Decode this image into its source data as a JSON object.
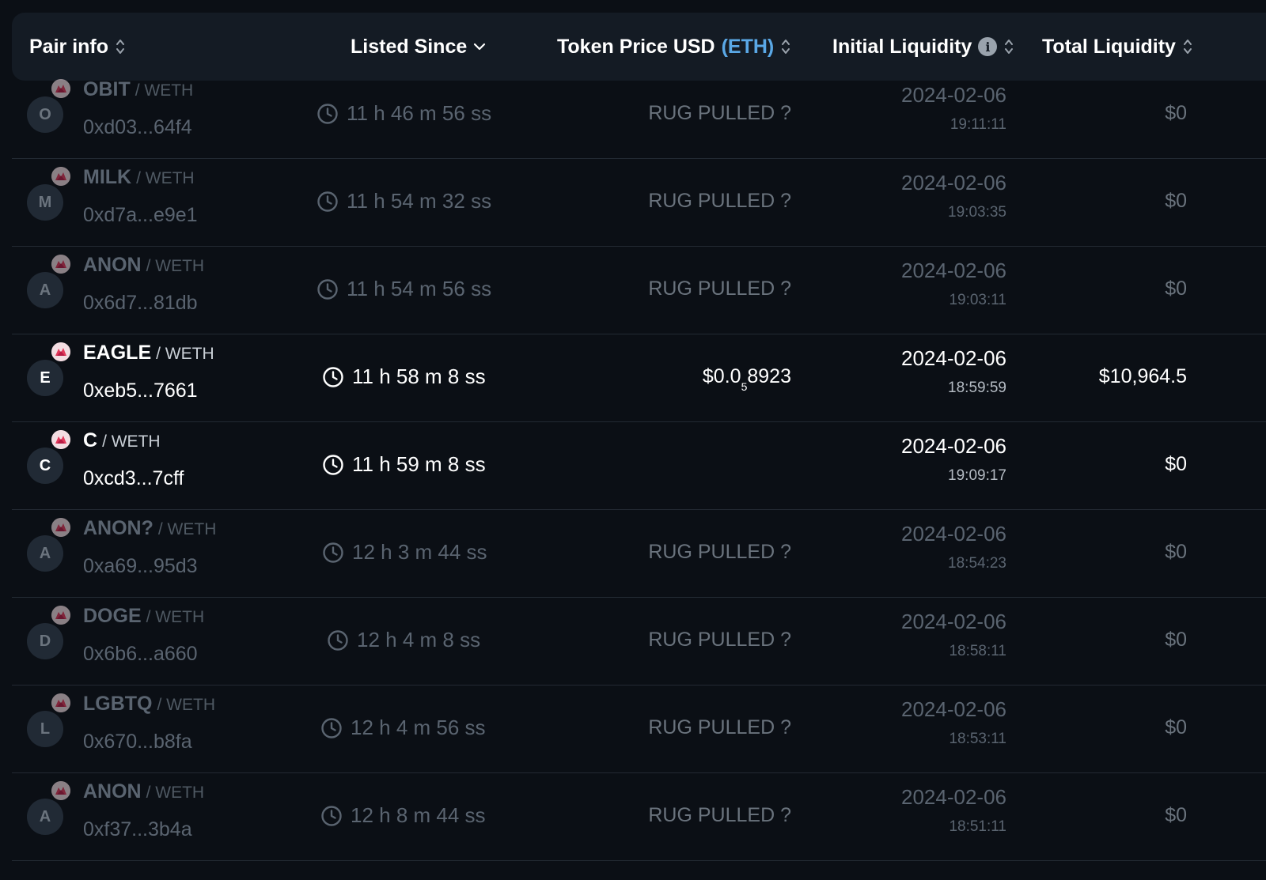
{
  "header": {
    "pair_info": "Pair info",
    "listed_since": "Listed Since",
    "token_price": "Token Price USD",
    "token_price_unit": "(ETH)",
    "initial_liquidity": "Initial Liquidity",
    "total_liquidity": "Total Liquidity"
  },
  "colors": {
    "background": "#0b0f15",
    "header_bg": "#141b24",
    "accent": "#5aa8e6",
    "dim_text": "#5a6470"
  },
  "icons": {
    "sort": "sort-icon",
    "chevron": "chevron-down-icon",
    "info": "info-icon",
    "clock": "clock-icon",
    "chain_badge": "chain-badge-icon"
  },
  "rows": [
    {
      "initial": "O",
      "symbol": "OBIT",
      "quote": "/ WETH",
      "address": "0xd03...64f4",
      "since": "11 h 46 m 56 ss",
      "price": "RUG PULLED ?",
      "date": "2024-02-06",
      "time": "19:11:11",
      "liquidity": "$0",
      "state": "dim"
    },
    {
      "initial": "M",
      "symbol": "MILK",
      "quote": "/ WETH",
      "address": "0xd7a...e9e1",
      "since": "11 h 54 m 32 ss",
      "price": "RUG PULLED ?",
      "date": "2024-02-06",
      "time": "19:03:35",
      "liquidity": "$0",
      "state": "dim"
    },
    {
      "initial": "A",
      "symbol": "ANON",
      "quote": "/ WETH",
      "address": "0x6d7...81db",
      "since": "11 h 54 m 56 ss",
      "price": "RUG PULLED ?",
      "date": "2024-02-06",
      "time": "19:03:11",
      "liquidity": "$0",
      "state": "dim"
    },
    {
      "initial": "E",
      "symbol": "EAGLE",
      "quote": "/ WETH",
      "address": "0xeb5...7661",
      "since": "11 h 58 m 8 ss",
      "price_main": "$0.0",
      "price_sub": "5",
      "price_tail": "8923",
      "date": "2024-02-06",
      "time": "18:59:59",
      "liquidity": "$10,964.5",
      "state": "bright"
    },
    {
      "initial": "C",
      "symbol": "C",
      "quote": "/ WETH",
      "address": "0xcd3...7cff",
      "since": "11 h 59 m 8 ss",
      "price": "",
      "date": "2024-02-06",
      "time": "19:09:17",
      "liquidity": "$0",
      "state": "bright"
    },
    {
      "initial": "A",
      "symbol": "ANON?",
      "quote": "/ WETH",
      "address": "0xa69...95d3",
      "since": "12 h 3 m 44 ss",
      "price": "RUG PULLED ?",
      "date": "2024-02-06",
      "time": "18:54:23",
      "liquidity": "$0",
      "state": "dim"
    },
    {
      "initial": "D",
      "symbol": "DOGE",
      "quote": "/ WETH",
      "address": "0x6b6...a660",
      "since": "12 h 4 m 8 ss",
      "price": "RUG PULLED ?",
      "date": "2024-02-06",
      "time": "18:58:11",
      "liquidity": "$0",
      "state": "dim"
    },
    {
      "initial": "L",
      "symbol": "LGBTQ",
      "quote": "/ WETH",
      "address": "0x670...b8fa",
      "since": "12 h 4 m 56 ss",
      "price": "RUG PULLED ?",
      "date": "2024-02-06",
      "time": "18:53:11",
      "liquidity": "$0",
      "state": "dim"
    },
    {
      "initial": "A",
      "symbol": "ANON",
      "quote": "/ WETH",
      "address": "0xf37...3b4a",
      "since": "12 h 8 m 44 ss",
      "price": "RUG PULLED ?",
      "date": "2024-02-06",
      "time": "18:51:11",
      "liquidity": "$0",
      "state": "dim"
    }
  ]
}
